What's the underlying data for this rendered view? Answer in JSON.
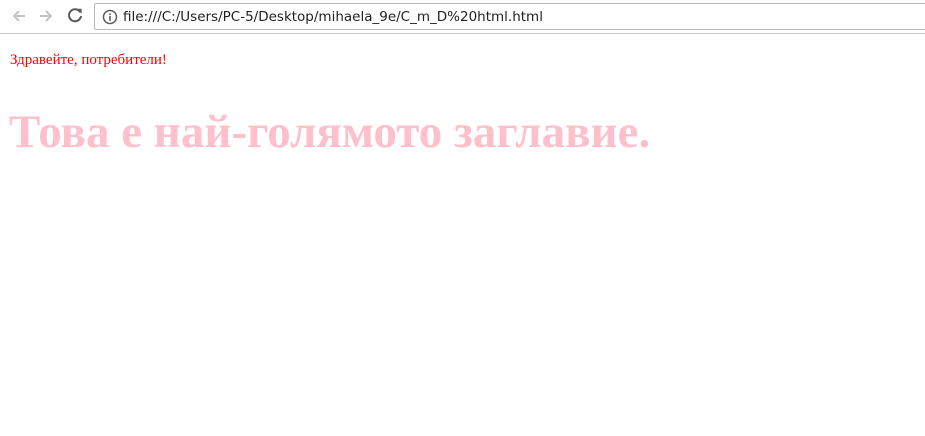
{
  "browser": {
    "url": "file:///C:/Users/PC-5/Desktop/mihaela_9e/C_m_D%20html.html",
    "icons": {
      "back": "arrow-left-icon",
      "forward": "arrow-right-icon",
      "reload": "reload-icon",
      "site_info": "info-icon"
    }
  },
  "page": {
    "greeting": "Здравейте, потребители!",
    "heading": "Това е най-голямото заглавие.",
    "colors": {
      "greeting": "#ff0000",
      "heading": "#ffc0cb"
    }
  }
}
